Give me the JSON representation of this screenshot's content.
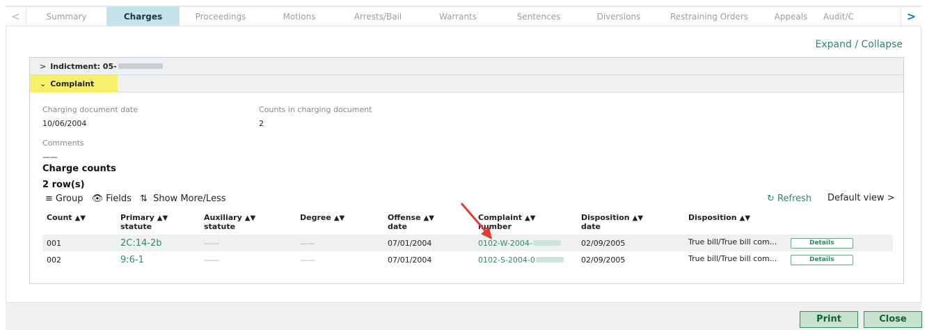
{
  "tabs": [
    "Summary",
    "Charges",
    "Proceedings",
    "Motions",
    "Arrests/Bail",
    "Warrants",
    "Sentences",
    "Diversions",
    "Restraining Orders",
    "Appeals",
    "Audit/C"
  ],
  "active_tab": "Charges",
  "expand_collapse": "Expand / Collapse",
  "indictment_label": "Indictment: 05-",
  "complaint_label": "Complaint",
  "fields": {
    "charging_doc_date_label": "Charging document date",
    "charging_doc_date": "10/06/2004",
    "counts_label": "Counts in charging document",
    "counts": "2",
    "comments_label": "Comments",
    "comments": "——"
  },
  "charge_counts_heading": "Charge counts",
  "rows_count": "2 row(s)",
  "toolbar": {
    "group": "Group",
    "fields": "Fields",
    "show": "Show More/Less",
    "refresh": "Refresh",
    "default_view": "Default view"
  },
  "columns": {
    "count": "Count",
    "primary": "Primary",
    "primary2": "statute",
    "auxiliary": "Auxiliary",
    "auxiliary2": "statute",
    "degree": "Degree",
    "offense": "Offense",
    "offense2": "date",
    "complaint": "Complaint",
    "complaint2": "number",
    "disp_date": "Disposition",
    "disp_date2": "date",
    "disposition": "Disposition"
  },
  "rows": [
    {
      "count": "001",
      "primary": "2C:14-2b",
      "auxiliary": "——",
      "degree": "——",
      "offense_date": "07/01/2004",
      "complaint": "0102-W-2004-",
      "disp_date": "02/09/2005",
      "disposition": "True bill/True bill com...",
      "details": "Details"
    },
    {
      "count": "002",
      "primary": "9:6-1",
      "auxiliary": "——",
      "degree": "——",
      "offense_date": "07/01/2004",
      "complaint": "0102-S-2004-0",
      "disp_date": "02/09/2005",
      "disposition": "True bill/True bill com...",
      "details": "Details"
    }
  ],
  "footer": {
    "print": "Print",
    "close": "Close"
  }
}
